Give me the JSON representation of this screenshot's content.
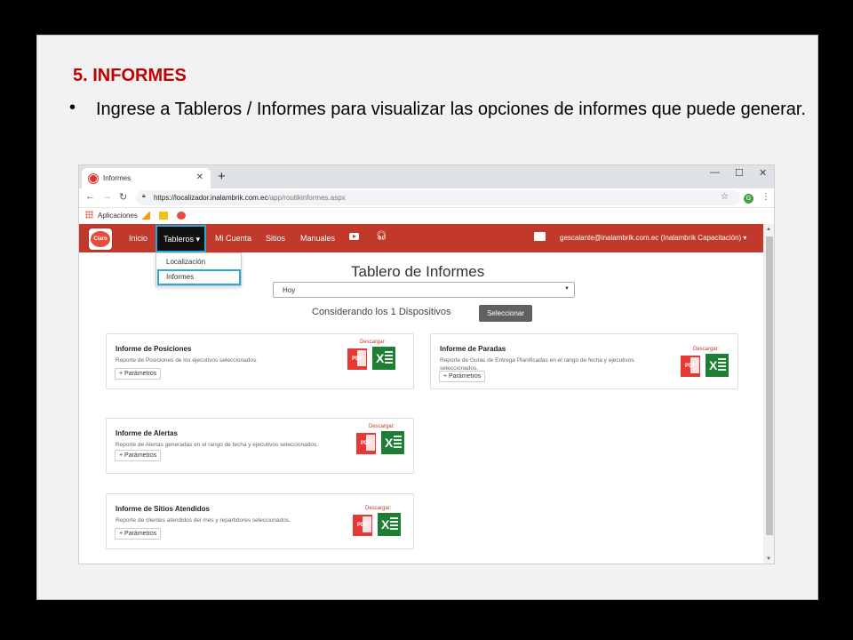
{
  "slide": {
    "title": "5. INFORMES",
    "bullet_text": "Ingrese a Tableros / Informes para visualizar las opciones de informes que puede generar."
  },
  "browser": {
    "tab_title": "Informes",
    "url_host": "https://localizador.inalambrik.com.ec",
    "url_path": "/app/routikinformes.aspx",
    "profile_initial": "G",
    "bookmark_apps_label": "Aplicaciones"
  },
  "app": {
    "logo_text": "Claro",
    "nav": {
      "inicio": "Inicio",
      "tableros": "Tableros ▾",
      "mi_cuenta": "Mi Cuenta",
      "sitios": "Sitios",
      "manuales": "Manuales"
    },
    "user_menu": "gescalante@inalambrik.com.ec (Inalambrik Capacitación) ▾",
    "dropdown": {
      "localizacion": "Localización",
      "informes": "Informes"
    },
    "dashboard_title": "Tablero de Informes",
    "period_value": "Hoy",
    "devices_text": "Considerando los 1 Dispositivos",
    "select_button": "Seleccionar",
    "download_label": "Descargar:",
    "pdf_label": "PDF",
    "xls_label": "X",
    "params_button": "+ Parámetros",
    "cards": [
      {
        "title": "Informe de Posiciones",
        "desc": "Reporte de Posiciones de los ejecutivos seleccionados."
      },
      {
        "title": "Informe de Paradas",
        "desc": "Reporte de Guías de Entrega Planificadas en el rango de fecha y ejecutivos seleccionados."
      },
      {
        "title": "Informe de Alertas",
        "desc": "Reporte de Alertas generadas en el rango de fecha y ejecutivos seleccionados."
      },
      {
        "title": "Informe de Sitios Atendidos",
        "desc": "Reporte de clientes atendidos del mes y repartidores seleccionados."
      }
    ]
  },
  "colors": {
    "title_red": "#c00000",
    "nav_red": "#c0392b",
    "highlight_blue": "#29a8e0"
  }
}
